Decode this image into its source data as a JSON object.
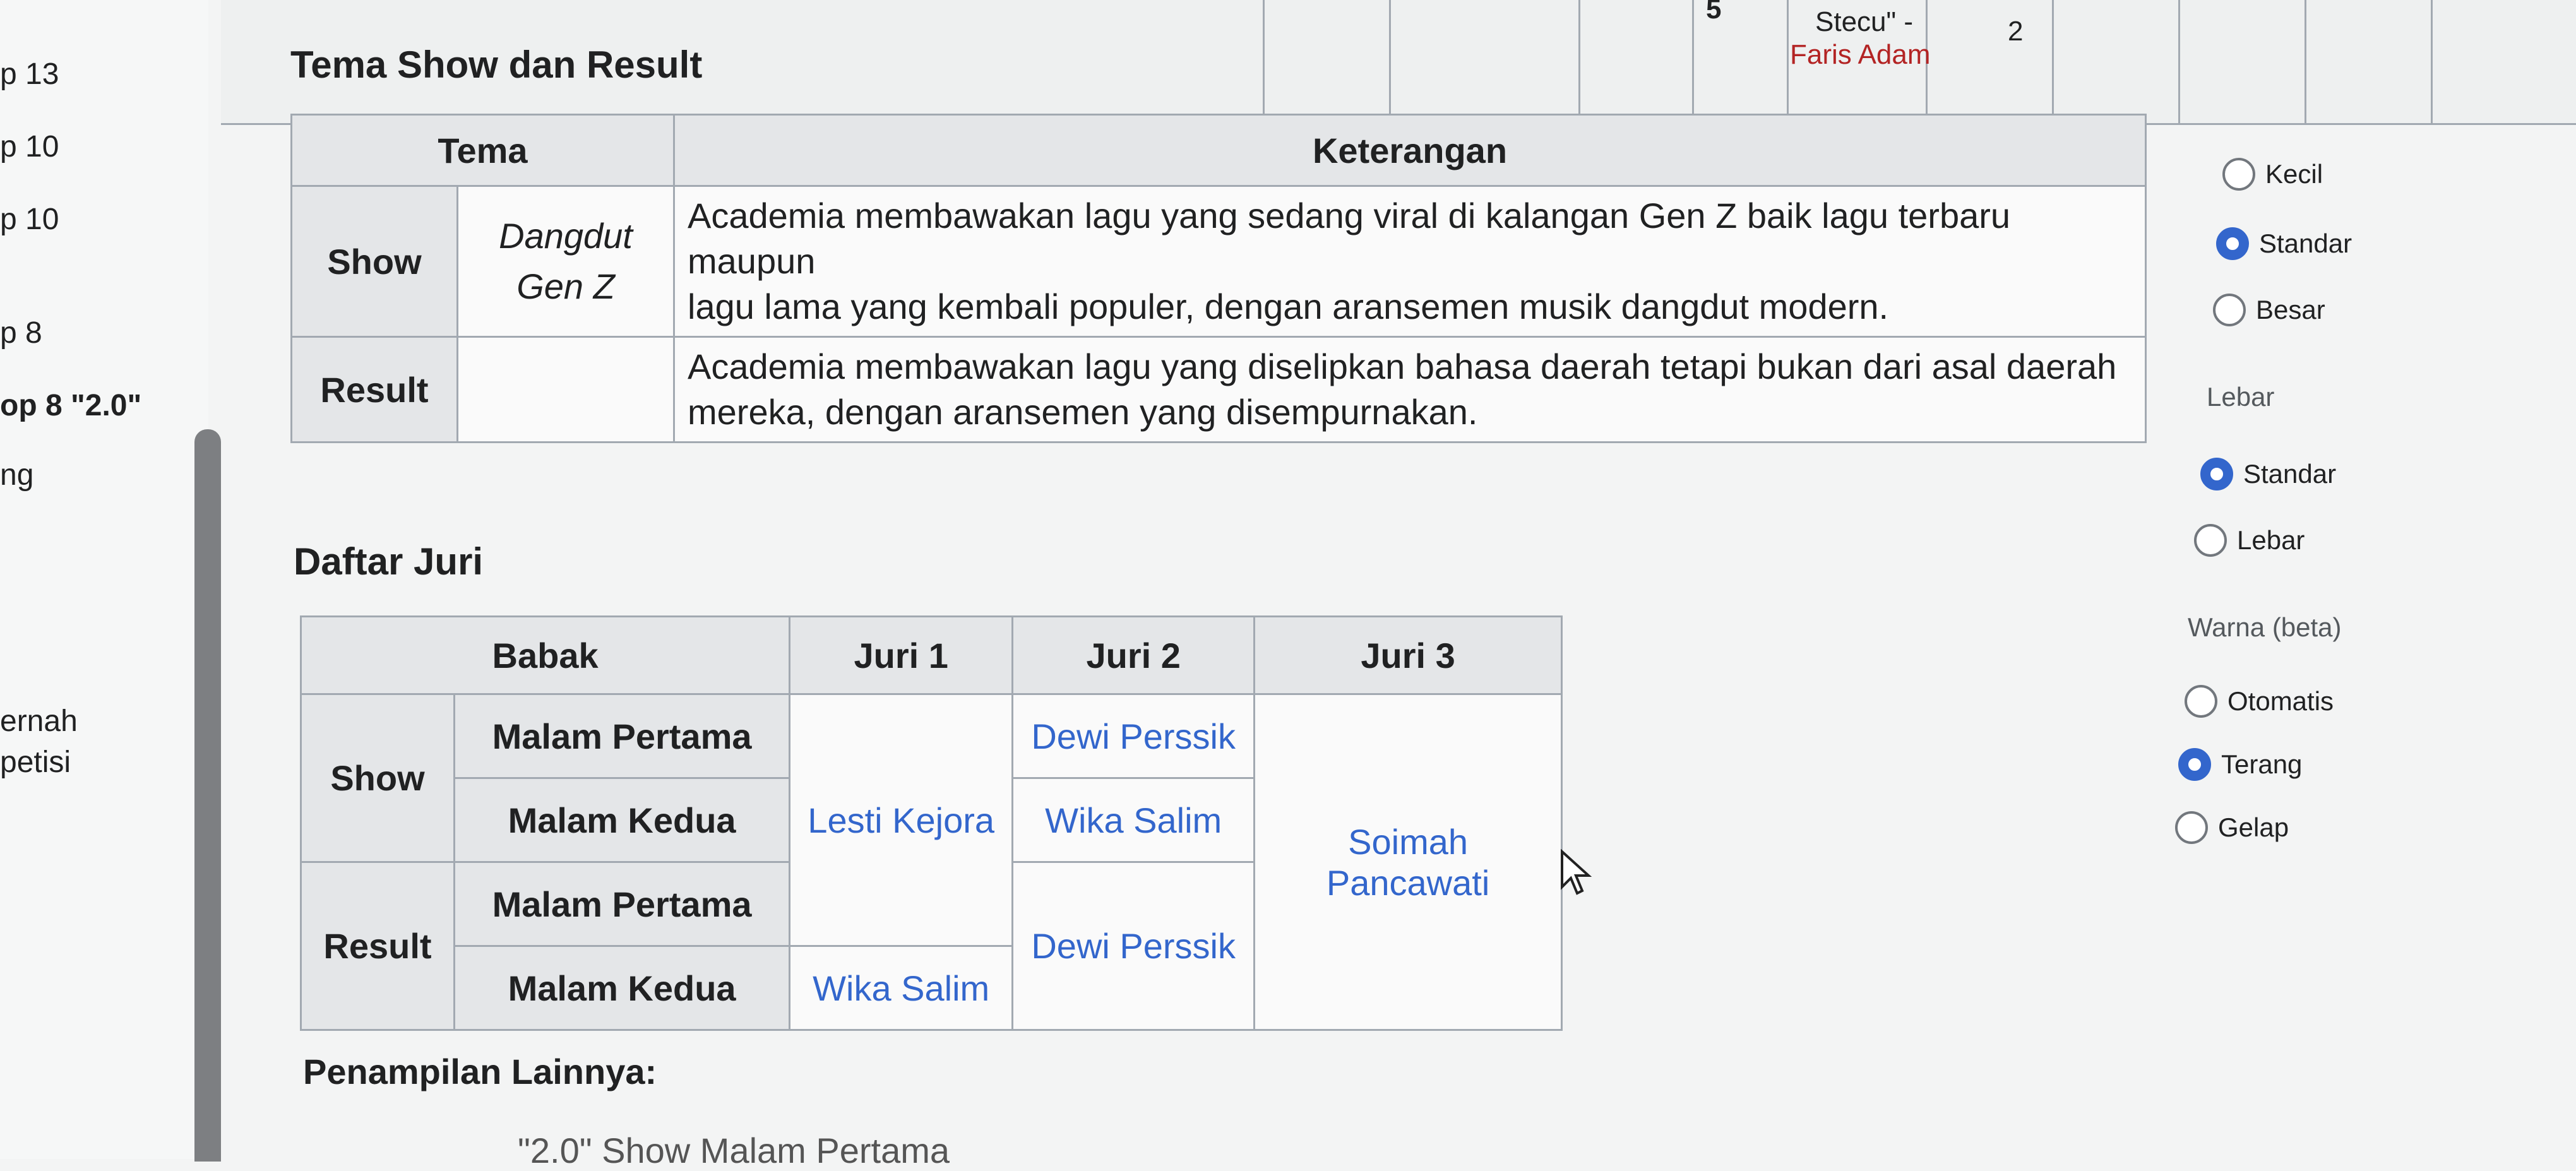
{
  "left_sidebar": {
    "items": [
      {
        "label": "p 13"
      },
      {
        "label": "p 10"
      },
      {
        "label": "p 10"
      },
      {
        "label": "p 8"
      },
      {
        "label": "op 8 \"2.0\""
      },
      {
        "label": "ng"
      },
      {
        "label": "ernah"
      },
      {
        "label": "petisi"
      }
    ]
  },
  "top_strip": {
    "number": "5",
    "name_line1": "Stecu\" -",
    "name_line2": "Faris Adam",
    "count": "2"
  },
  "theme_section": {
    "title": "Tema Show dan Result",
    "headers": {
      "tema": "Tema",
      "keterangan": "Keterangan"
    },
    "rows": [
      {
        "babak": "Show",
        "tema": "Dangdut Gen Z",
        "tema_line1": "Dangdut",
        "tema_line2": "Gen Z",
        "keterangan_line1": "Academia membawakan lagu yang sedang viral di kalangan Gen Z baik lagu terbaru maupun",
        "keterangan_line2": "lagu lama yang kembali populer, dengan aransemen musik dangdut modern."
      },
      {
        "babak": "Result",
        "tema": "",
        "keterangan_line1": "Academia membawakan lagu yang diselipkan bahasa daerah tetapi bukan dari asal daerah",
        "keterangan_line2": "mereka, dengan aransemen yang disempurnakan."
      }
    ]
  },
  "jury_section": {
    "title": "Daftar Juri",
    "headers": {
      "babak": "Babak",
      "juri1": "Juri 1",
      "juri2": "Juri 2",
      "juri3": "Juri 3"
    },
    "groups": [
      {
        "babak": "Show",
        "malam1": "Malam Pertama",
        "malam2": "Malam Kedua"
      },
      {
        "babak": "Result",
        "malam1": "Malam Pertama",
        "malam2": "Malam Kedua"
      }
    ],
    "juri1": {
      "a": "Lesti Kejora",
      "b": "Wika Salim"
    },
    "juri2": {
      "a": "Dewi Perssik",
      "b": "Wika Salim",
      "c": "Dewi Perssik"
    },
    "juri3": {
      "a": "Soimah Pancawati"
    }
  },
  "other_section": {
    "title": "Penampilan Lainnya:",
    "partial_line": "\"2.0\" Show Malam Pertama"
  },
  "settings_panel": {
    "size_options": [
      {
        "label": "Kecil",
        "checked": false
      },
      {
        "label": "Standar",
        "checked": true
      },
      {
        "label": "Besar",
        "checked": false
      }
    ],
    "width_label": "Lebar",
    "width_options": [
      {
        "label": "Standar",
        "checked": true
      },
      {
        "label": "Lebar",
        "checked": false
      }
    ],
    "color_label": "Warna (beta)",
    "color_options": [
      {
        "label": "Otomatis",
        "checked": false
      },
      {
        "label": "Terang",
        "checked": true
      },
      {
        "label": "Gelap",
        "checked": false
      }
    ]
  },
  "colors": {
    "link": "#3366cc",
    "radio_checked": "#3366cc",
    "header_bg": "#e4e6e8",
    "border": "#a2a9b1"
  }
}
